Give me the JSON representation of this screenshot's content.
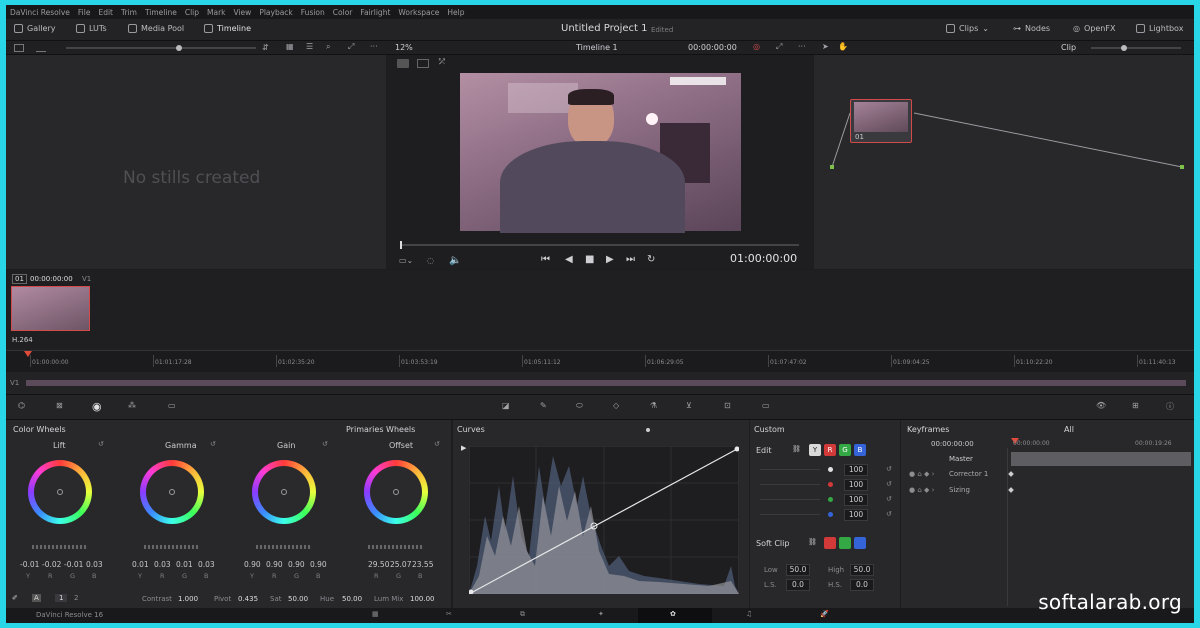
{
  "menu": [
    "DaVinci Resolve",
    "File",
    "Edit",
    "Trim",
    "Timeline",
    "Clip",
    "Mark",
    "View",
    "Playback",
    "Fusion",
    "Color",
    "Fairlight",
    "Workspace",
    "Help"
  ],
  "toolbar": {
    "gallery": "Gallery",
    "luts": "LUTs",
    "media_pool": "Media Pool",
    "timeline": "Timeline",
    "project_title": "Untitled Project 1",
    "project_state": "Edited",
    "clips": "Clips",
    "nodes": "Nodes",
    "openfx": "OpenFX",
    "lightbox": "Lightbox"
  },
  "subbar": {
    "zoom": "12%",
    "timeline_name": "Timeline 1",
    "timecode": "00:00:00:00",
    "clip_mode": "Clip"
  },
  "gallery": {
    "empty_text": "No stills created"
  },
  "viewer": {
    "timecode": "01:00:00:00"
  },
  "node": {
    "label": "01"
  },
  "clip": {
    "index": "01",
    "timecode": "00:00:00:00",
    "track": "V1",
    "codec": "H.264"
  },
  "ruler": {
    "ticks": [
      "01:00:00:00",
      "01:01:17:28",
      "01:02:35:20",
      "01:03:53:19",
      "01:05:11:12",
      "01:06:29:05",
      "01:07:47:02",
      "01:09:04:25",
      "01:10:22:20",
      "01:11:40:13"
    ],
    "track_label": "V1"
  },
  "color_wheels": {
    "title": "Color Wheels",
    "mode": "Primaries Wheels",
    "wheels": [
      {
        "name": "Lift",
        "values": [
          "-0.01",
          "-0.02",
          "-0.01",
          "0.03"
        ]
      },
      {
        "name": "Gamma",
        "values": [
          "0.01",
          "0.03",
          "0.01",
          "0.03"
        ]
      },
      {
        "name": "Gain",
        "values": [
          "0.90",
          "0.90",
          "0.90",
          "0.90"
        ]
      },
      {
        "name": "Offset",
        "values": [
          "29.50",
          "25.07",
          "23.55"
        ]
      }
    ],
    "channel_labels": [
      "Y",
      "R",
      "G",
      "B"
    ],
    "offset_labels": [
      "R",
      "G",
      "B"
    ],
    "page_1": "1",
    "page_2": "2",
    "contrast_label": "Contrast",
    "contrast": "1.000",
    "pivot_label": "Pivot",
    "pivot": "0.435",
    "sat_label": "Sat",
    "sat": "50.00",
    "hue_label": "Hue",
    "hue": "50.00",
    "lummix_label": "Lum Mix",
    "lummix": "100.00"
  },
  "curves": {
    "title": "Curves",
    "mode": "Custom"
  },
  "edit": {
    "title": "Edit",
    "y_chip": "Y",
    "r_chip": "R",
    "g_chip": "G",
    "b_chip": "B",
    "values": [
      "100",
      "100",
      "100",
      "100"
    ],
    "softclip": "Soft Clip",
    "low_label": "Low",
    "low": "50.0",
    "high_label": "High",
    "high": "50.0",
    "ls_label": "L.S.",
    "ls": "0.0",
    "hs_label": "H.S.",
    "hs": "0.0"
  },
  "keyframes": {
    "title": "Keyframes",
    "filter": "All",
    "timecode": "00:00:00:00",
    "tick_1": "00:00:00:00",
    "tick_2": "00:00:19:26",
    "master": "Master",
    "tracks": [
      "Corrector 1",
      "Sizing"
    ]
  },
  "pagebar": {
    "app_name": "DaVinci Resolve 16"
  },
  "watermark": "softalarab.org"
}
